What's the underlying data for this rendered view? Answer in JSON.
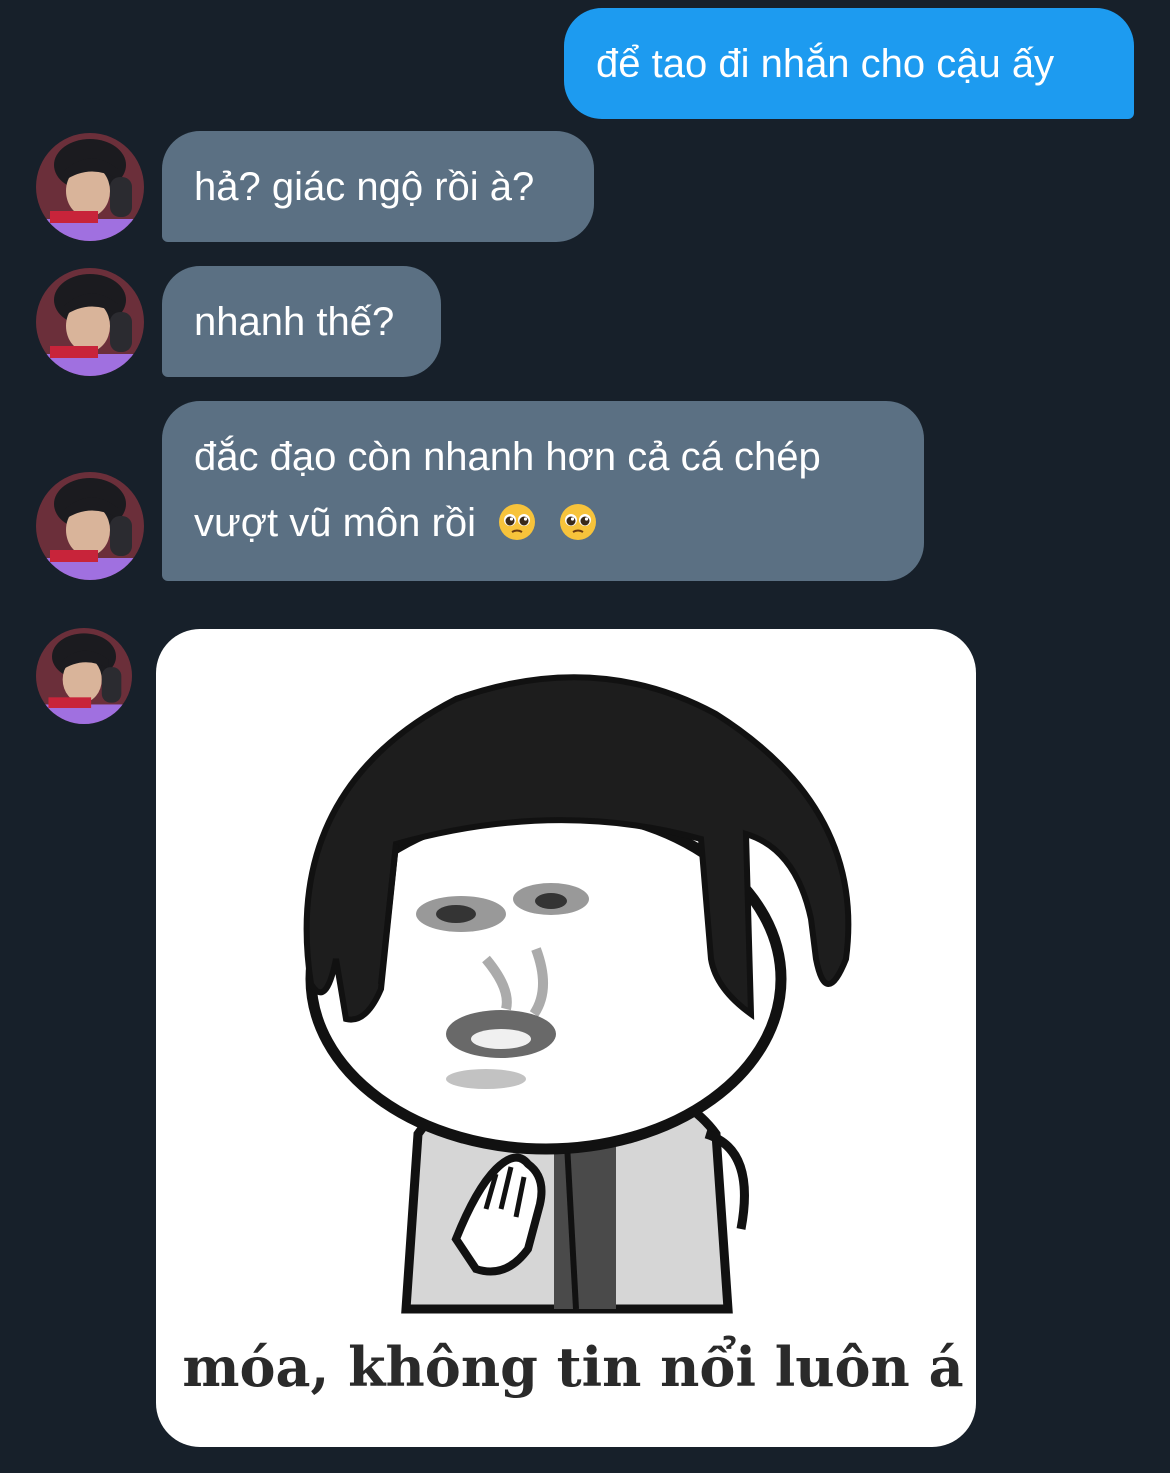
{
  "messages": [
    {
      "id": "m1",
      "direction": "outgoing",
      "text": "để tao đi nhắn cho cậu ấy"
    },
    {
      "id": "m2",
      "direction": "incoming",
      "text": "hả? giác ngộ rồi à?"
    },
    {
      "id": "m3",
      "direction": "incoming",
      "text": "nhanh thế?"
    },
    {
      "id": "m4",
      "direction": "incoming",
      "line1": "đắc đạo còn nhanh hơn cả cá chép",
      "line2": "vượt vũ môn rồi",
      "emojis": [
        "pleading-face-emoji",
        "pleading-face-emoji"
      ]
    },
    {
      "id": "m5",
      "direction": "incoming",
      "type": "image",
      "caption": "móa, không tin nổi luôn á"
    }
  ],
  "colors": {
    "background": "#17202a",
    "outgoing_bubble": "#1d9bf0",
    "incoming_bubble": "#5b7083",
    "text": "#ffffff"
  }
}
